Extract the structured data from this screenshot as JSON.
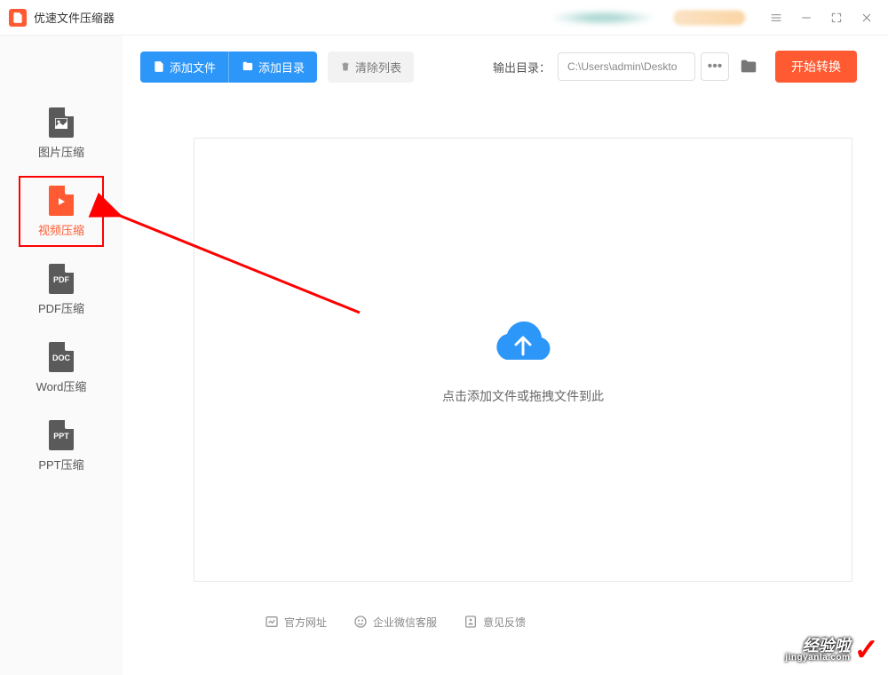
{
  "app": {
    "title": "优速文件压缩器"
  },
  "sidebar": {
    "items": [
      {
        "label": "图片压缩",
        "badge": ""
      },
      {
        "label": "视频压缩",
        "badge": ""
      },
      {
        "label": "PDF压缩",
        "badge": "PDF"
      },
      {
        "label": "Word压缩",
        "badge": "DOC"
      },
      {
        "label": "PPT压缩",
        "badge": "PPT"
      }
    ]
  },
  "toolbar": {
    "addFile": "添加文件",
    "addDir": "添加目录",
    "clearList": "清除列表",
    "outputLabel": "输出目录：",
    "outputPath": "C:\\Users\\admin\\Deskto",
    "dots": "•••",
    "start": "开始转换"
  },
  "dropzone": {
    "text": "点击添加文件或拖拽文件到此"
  },
  "footer": {
    "site": "官方网址",
    "support": "企业微信客服",
    "feedback": "意见反馈"
  },
  "watermark": {
    "main": "经验啦",
    "sub": "jingyanla.com",
    "check": "✓"
  }
}
